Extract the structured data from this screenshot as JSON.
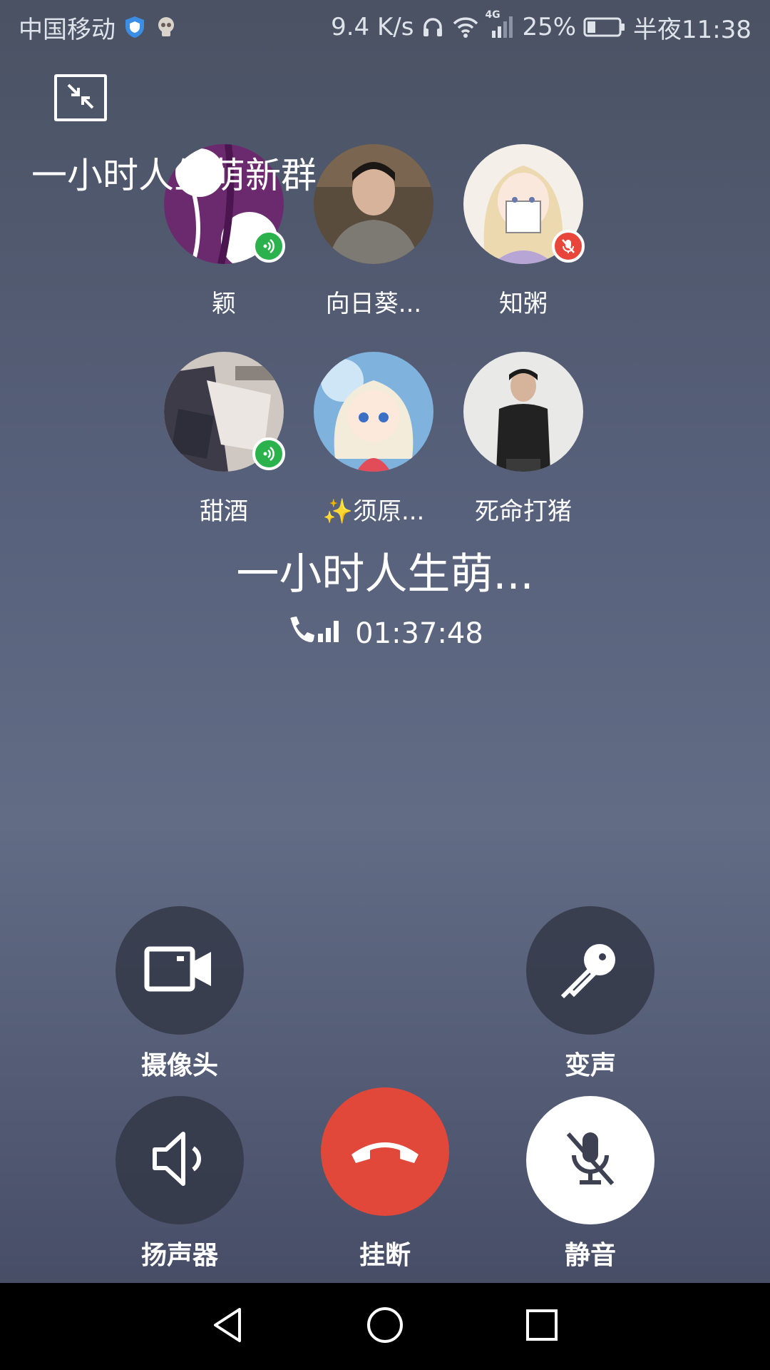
{
  "status_bar": {
    "carrier": "中国移动",
    "network_speed": "9.4 K/s",
    "network_type": "4G",
    "battery": "25%",
    "time": "半夜11:38"
  },
  "header": {
    "group_title": "一小时人生萌新群"
  },
  "participants": [
    {
      "name": "颖",
      "status": "speaking"
    },
    {
      "name": "向日葵...",
      "status": "none"
    },
    {
      "name": "知粥",
      "status": "muted"
    },
    {
      "name": "甜酒",
      "status": "speaking"
    },
    {
      "name": "✨须原...",
      "status": "none"
    },
    {
      "name": "死命打猪",
      "status": "none"
    }
  ],
  "call": {
    "name": "一小时人生萌...",
    "duration": "01:37:48"
  },
  "controls": {
    "camera_label": "摄像头",
    "voice_change_label": "变声",
    "speaker_label": "扬声器",
    "hangup_label": "挂断",
    "mute_label": "静音"
  },
  "colors": {
    "speaking_badge": "#2bb24c",
    "muted_badge": "#e8463a",
    "hangup": "#e2483a"
  }
}
